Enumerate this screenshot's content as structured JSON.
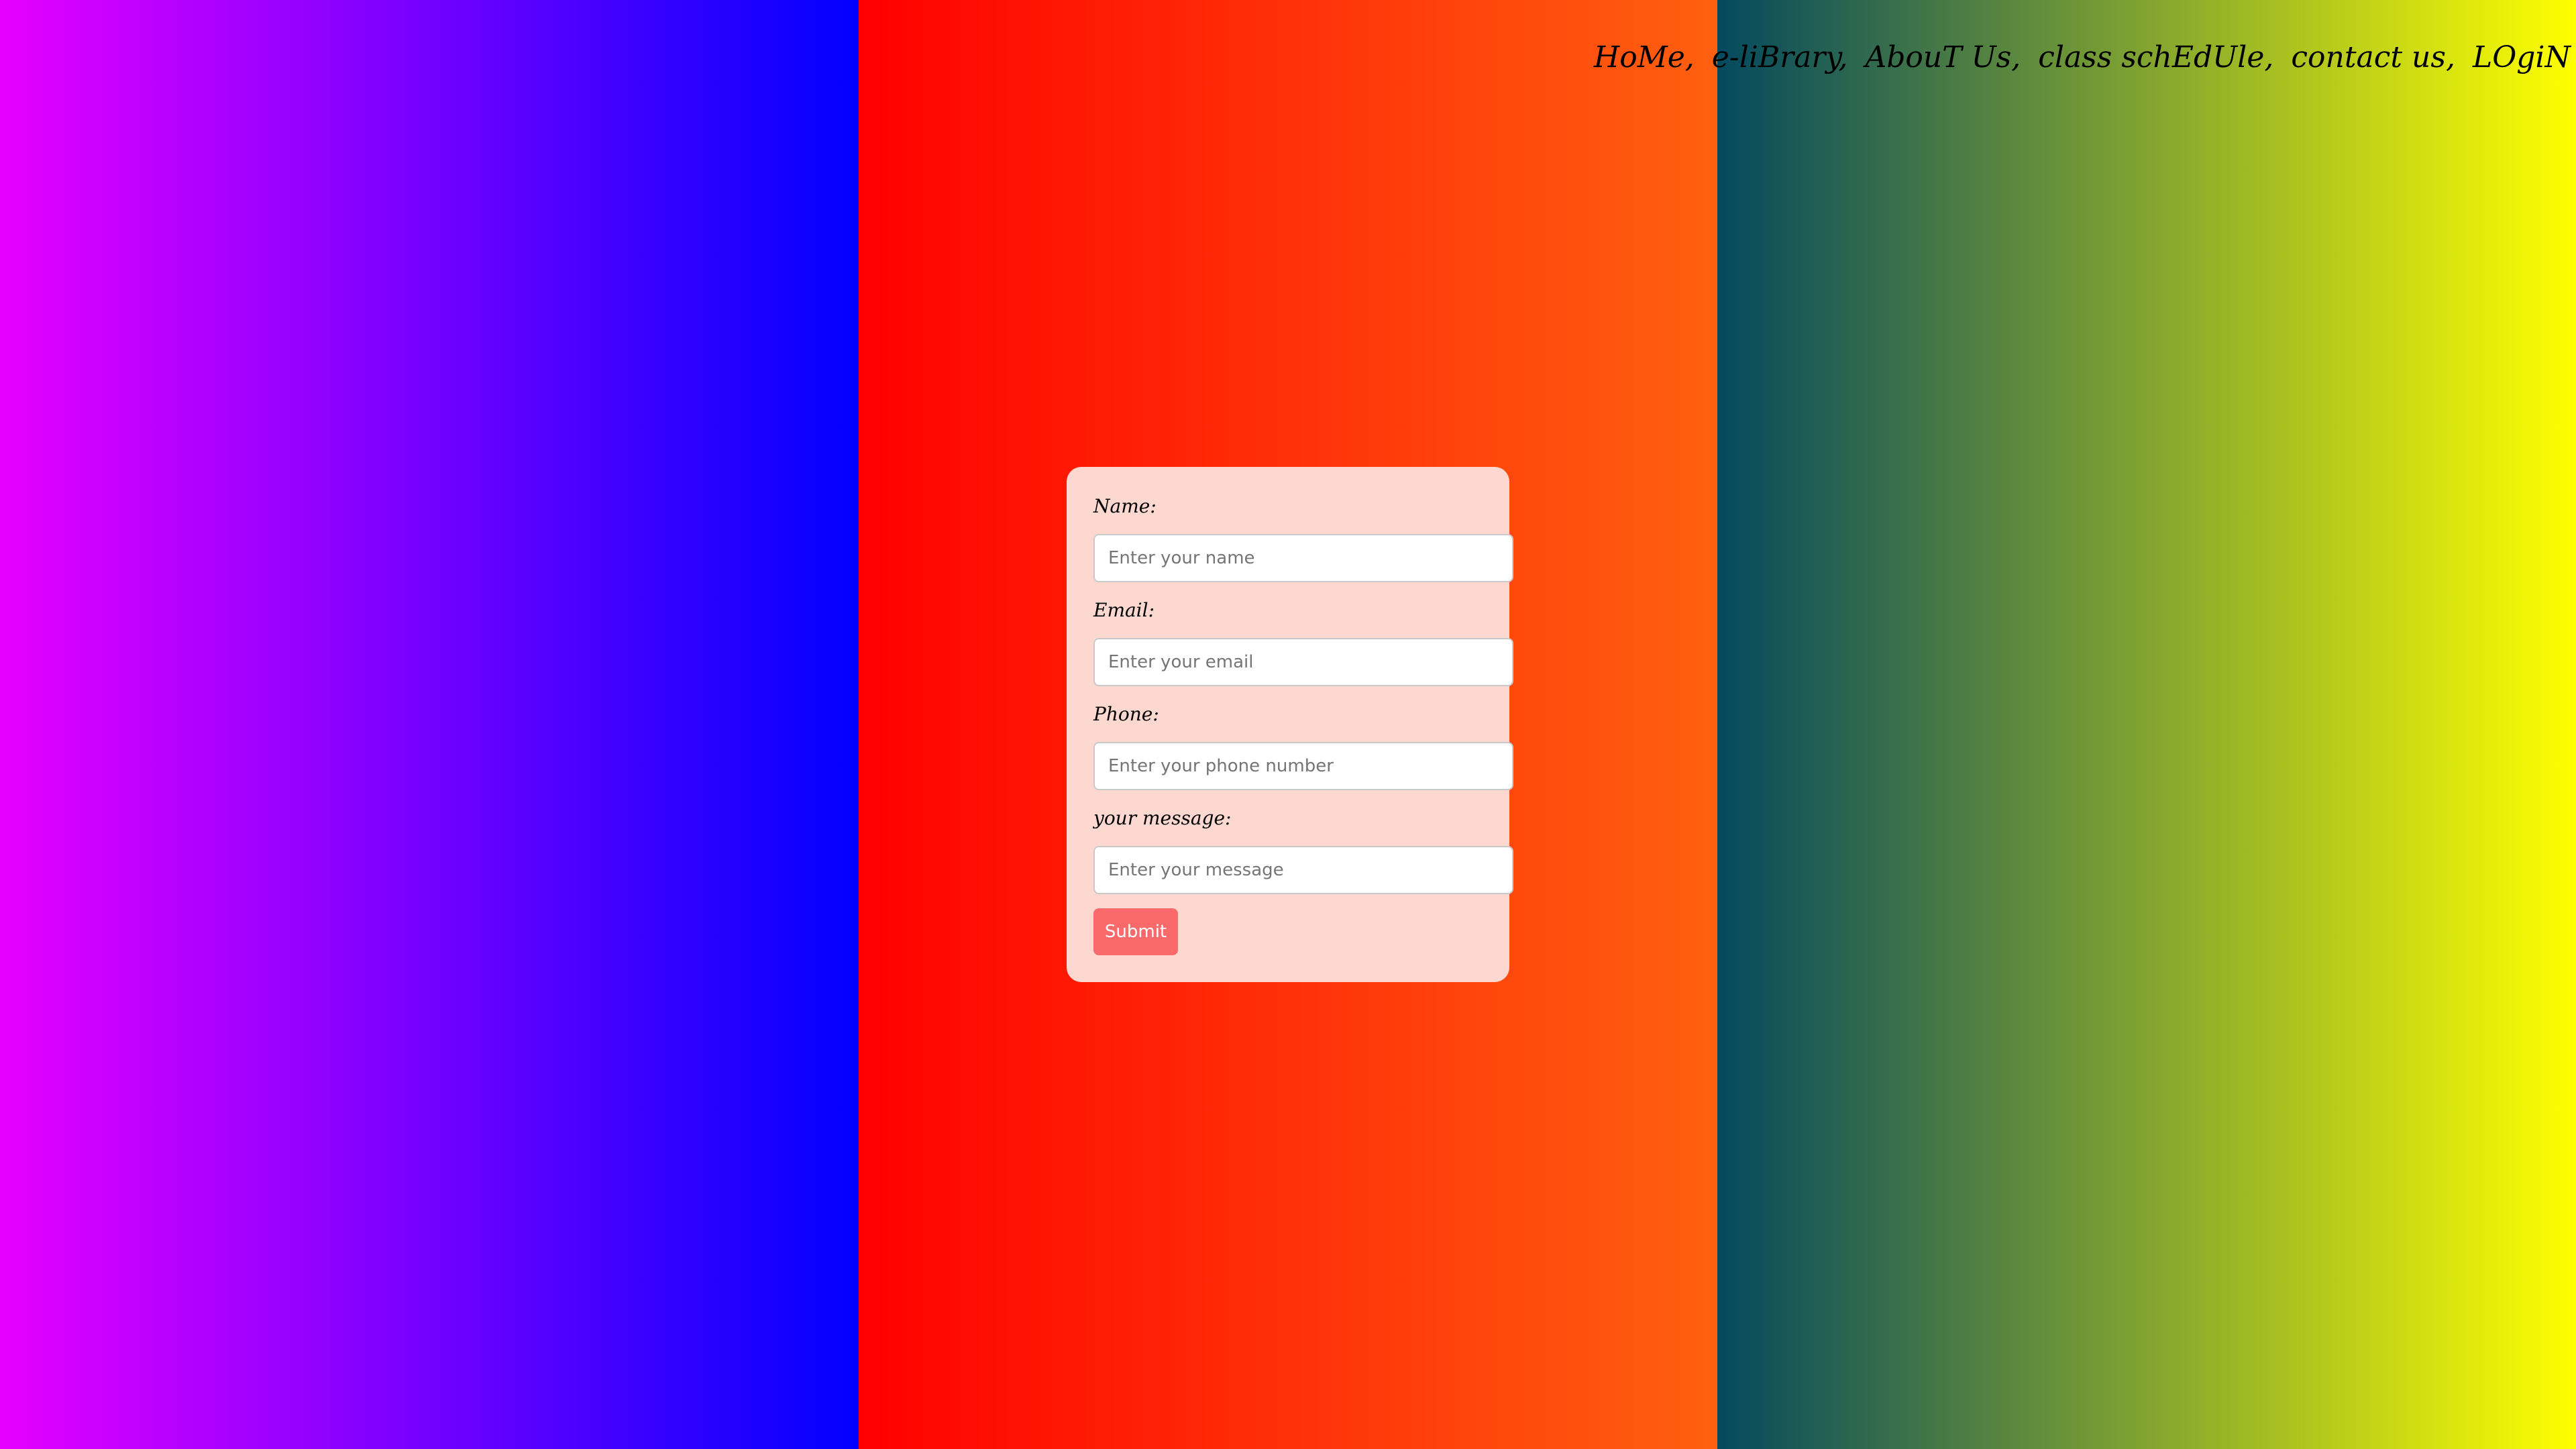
{
  "nav": {
    "items": [
      {
        "label": "HoMe,"
      },
      {
        "label": "e-liBrary,"
      },
      {
        "label": "AbouT Us,"
      },
      {
        "label": "class schEdUle,"
      },
      {
        "label": "contact us,"
      },
      {
        "label": "LOgiN"
      }
    ]
  },
  "form": {
    "name_label": "Name:",
    "name_placeholder": "Enter your name",
    "email_label": "Email:",
    "email_placeholder": "Enter your email",
    "phone_label": "Phone:",
    "phone_placeholder": "Enter your phone number",
    "message_label": "your message:",
    "message_placeholder": "Enter your message",
    "submit_label": "Submit"
  },
  "colors": {
    "left_panel_start": "#e600ff",
    "left_panel_end": "#0000ff",
    "middle_panel_start": "#ff0000",
    "middle_panel_end": "#ff6010",
    "right_panel_start": "#04495f",
    "right_panel_end": "#ffff00",
    "form_background": "#fdd8d0",
    "submit_button": "#fb6a6a"
  }
}
